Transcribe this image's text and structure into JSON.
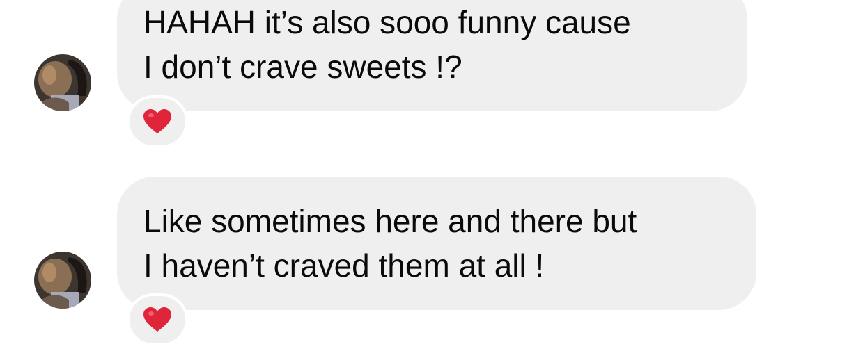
{
  "messages": [
    {
      "lines": [
        "HAHAH it’s also sooo funny cause",
        "I don’t crave sweets !?"
      ],
      "reaction": "red-heart-icon",
      "sender_avatar": "avatar"
    },
    {
      "lines": [
        "Like sometimes here and there but",
        "I haven’t craved them at all !"
      ],
      "reaction": "red-heart-icon",
      "sender_avatar": "avatar"
    }
  ],
  "colors": {
    "bubble_bg": "#efefef",
    "text": "#0a0a0a",
    "heart": "#e0243a",
    "page_bg": "#ffffff"
  }
}
